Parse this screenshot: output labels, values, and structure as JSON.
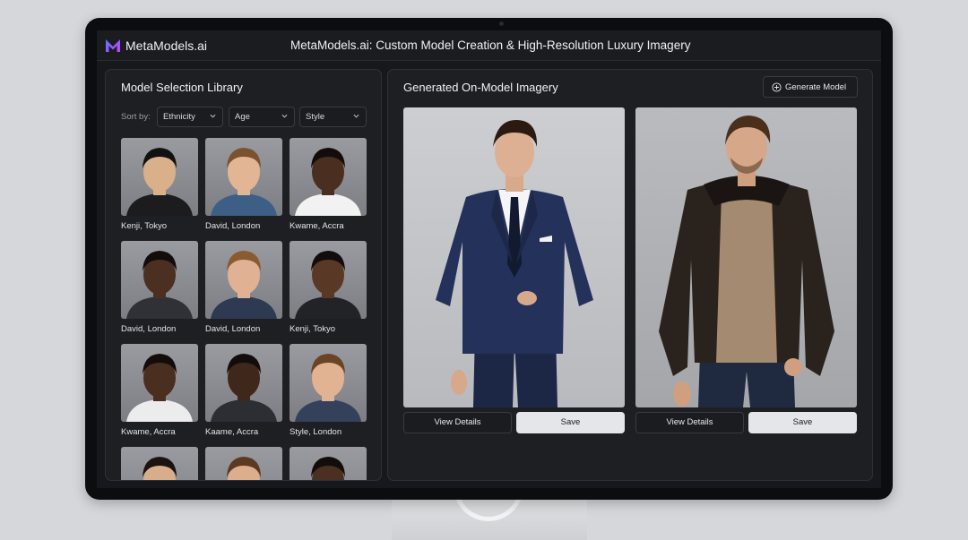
{
  "topbar": {
    "brand": "MetaModels.ai",
    "title": "MetaModels.ai: Custom Model Creation & High-Resolution Luxury Imagery",
    "logo_icon": "m-logo-icon"
  },
  "library": {
    "title": "Model Selection Library",
    "sort_label": "Sort by:",
    "filters": [
      {
        "label": "Ethnicity"
      },
      {
        "label": "Age"
      },
      {
        "label": "Style"
      }
    ],
    "models": [
      {
        "name": "Kenji, Tokyo",
        "skin": "#d9b08a",
        "hair": "#111111",
        "shirt": "#1c1c1e"
      },
      {
        "name": "David, London",
        "skin": "#e2b595",
        "hair": "#7a5230",
        "shirt": "#3d5f86"
      },
      {
        "name": "Kwame, Accra",
        "skin": "#4a2e1f",
        "hair": "#120d0a",
        "shirt": "#f2f2f2"
      },
      {
        "name": "David, London",
        "skin": "#4b2f20",
        "hair": "#120d0a",
        "shirt": "#2f3136"
      },
      {
        "name": "David, London",
        "skin": "#e0b293",
        "hair": "#8a5a30",
        "shirt": "#2d3a52"
      },
      {
        "name": "Kenji, Tokyo",
        "skin": "#5a3826",
        "hair": "#120d0a",
        "shirt": "#222326"
      },
      {
        "name": "Kwame, Accra",
        "skin": "#4a2e1f",
        "hair": "#120d0a",
        "shirt": "#ececec"
      },
      {
        "name": "Kaame, Accra",
        "skin": "#3f271b",
        "hair": "#120d0a",
        "shirt": "#2c2e33"
      },
      {
        "name": "Style, London",
        "skin": "#e2b393",
        "hair": "#6a4424",
        "shirt": "#34415a"
      },
      {
        "name": "",
        "skin": "#d7ad8b",
        "hair": "#1a1310",
        "shirt": "#3a3b40"
      },
      {
        "name": "",
        "skin": "#dcae8d",
        "hair": "#5a3a22",
        "shirt": "#3a3b40"
      },
      {
        "name": "",
        "skin": "#4b2f20",
        "hair": "#120d0a",
        "shirt": "#3a3b40"
      }
    ]
  },
  "imagery": {
    "title": "Generated On-Model Imagery",
    "generate_label": "Generate Model",
    "cards": [
      {
        "view_label": "View Details",
        "save_label": "Save",
        "outfit": "navy-suit"
      },
      {
        "view_label": "View Details",
        "save_label": "Save",
        "outfit": "leather-jacket"
      }
    ]
  },
  "colors": {
    "accent_logo_start": "#4f7cff",
    "accent_logo_end": "#d23cff",
    "panel_bg": "#1e1f23",
    "save_button_bg": "#e5e6ea"
  }
}
